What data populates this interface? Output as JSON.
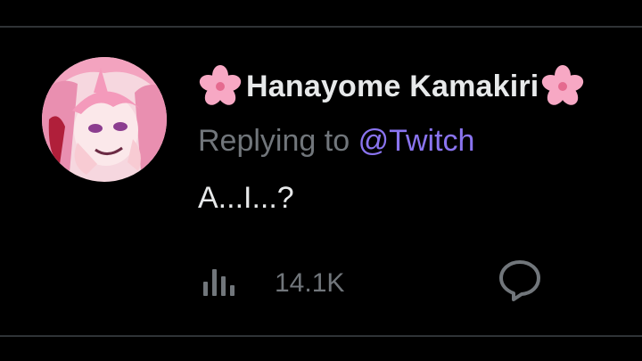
{
  "tweet": {
    "author": {
      "display_name": "Hanayome Kamakiri",
      "name_decoration_icon": "cherry-blossom-icon",
      "avatar_icon": "anime-avatar"
    },
    "reply": {
      "prefix": "Replying to",
      "handle": "@Twitch"
    },
    "text": "A...I...?",
    "stats": {
      "views_icon": "bar-chart-icon",
      "views": "14.1K",
      "reply_icon": "speech-bubble-icon"
    }
  },
  "colors": {
    "background": "#000000",
    "text_primary": "#e7e9ea",
    "text_secondary": "#71767b",
    "mention": "#8a74f0",
    "divider": "#2f3336",
    "blossom": "#f7a8c4"
  }
}
